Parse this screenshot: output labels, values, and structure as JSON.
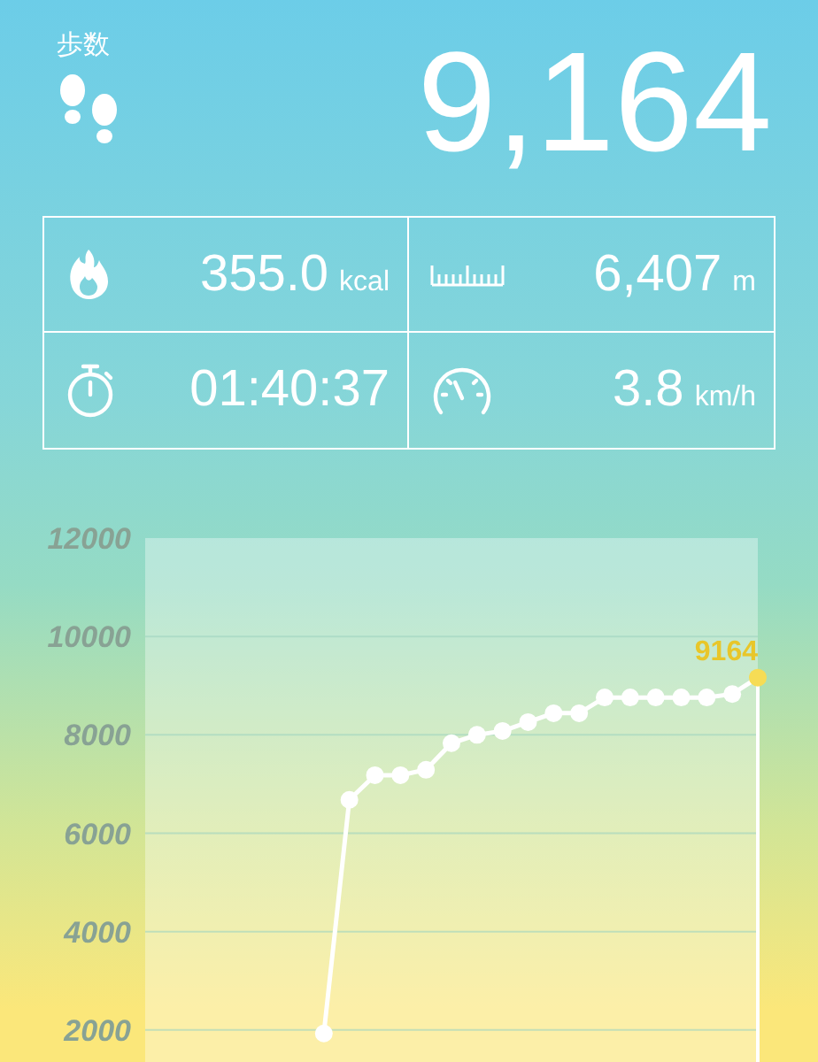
{
  "header": {
    "label": "歩数",
    "steps": "9,164"
  },
  "stats": [
    {
      "kind": "calories",
      "value": "355.0",
      "unit": "kcal"
    },
    {
      "kind": "distance",
      "value": "6,407",
      "unit": "m"
    },
    {
      "kind": "duration",
      "value": "01:40:37"
    },
    {
      "kind": "speed",
      "value": "3.8",
      "unit": "km/h"
    }
  ],
  "chart_data": {
    "type": "line",
    "grid": true,
    "categories": [
      null,
      null,
      null,
      null,
      null,
      null,
      null,
      null,
      null,
      null,
      null,
      null,
      null,
      null,
      null,
      null,
      null,
      null
    ],
    "ylim": [
      1350,
      12000
    ],
    "yticks": [
      2000,
      4000,
      6000,
      8000,
      10000,
      12000
    ],
    "series": [
      {
        "color": "#ffffff",
        "marker": "circle",
        "values": [
          1930,
          6680,
          7180,
          7180,
          7290,
          7830,
          8000,
          8080,
          8260,
          8440,
          8440,
          8760,
          8760,
          8760,
          8760,
          8760,
          8830,
          9164
        ]
      }
    ],
    "annotations": [
      {
        "text": "9164"
      }
    ]
  }
}
